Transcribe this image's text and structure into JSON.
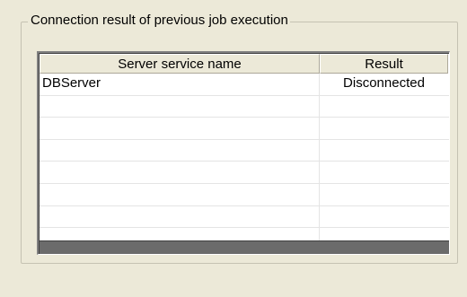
{
  "group": {
    "title": "Connection result of previous job execution"
  },
  "table": {
    "columns": [
      "Server service name",
      "Result"
    ],
    "rows": [
      {
        "name": "DBServer",
        "result": "Disconnected"
      },
      {
        "name": "",
        "result": ""
      },
      {
        "name": "",
        "result": ""
      },
      {
        "name": "",
        "result": ""
      },
      {
        "name": "",
        "result": ""
      },
      {
        "name": "",
        "result": ""
      },
      {
        "name": "",
        "result": ""
      },
      {
        "name": "",
        "result": ""
      }
    ]
  }
}
